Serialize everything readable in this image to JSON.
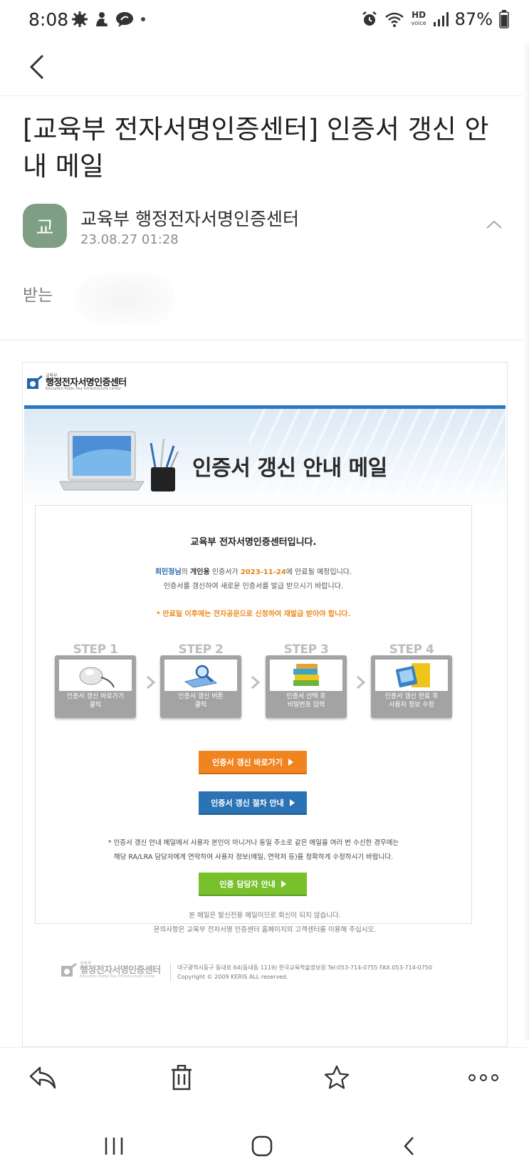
{
  "status_bar": {
    "time": "8:08",
    "hd_label": "HD",
    "voice_label": "voice",
    "battery": "87%"
  },
  "mail": {
    "subject": "[교육부 전자서명인증센터] 인증서 갱신 안내 메일",
    "avatar_letter": "교",
    "sender": "교육부 행정전자서명인증센터",
    "date": "23.08.27 01:28",
    "recipient_label": "받는"
  },
  "email_body": {
    "logo_sup": "교육부",
    "logo_name": "행정전자서명인증센터",
    "logo_sub": "Education Public Key Infrastructure Center",
    "banner_title": "인증서 갱신 안내 메일",
    "intro_title": "교육부 전자서명인증센터입니다.",
    "line1": {
      "name": "최민정님",
      "p1": "의 ",
      "type": "개인용",
      "p2": " 인증서가 ",
      "expiry": "2023-11-24",
      "p3": "에 만료될 예정입니다."
    },
    "line2": "인증서를 갱신하여 새로운 인증서를 발급 받으시기 바랍니다.",
    "warning": "* 만료일 이후에는 전자공문으로 신청하여 재발급 받아야 합니다.",
    "steps": [
      {
        "label": "STEP 1",
        "text1": "인증서 갱신 바로가기",
        "text2": "클릭",
        "icon": "mouse-icon"
      },
      {
        "label": "STEP 2",
        "text1": "인증서 갱신 버튼",
        "text2": "클릭",
        "icon": "magnifier-icon"
      },
      {
        "label": "STEP 3",
        "text1": "인증서 선택 후",
        "text2": "비밀번호 입력",
        "icon": "books-icon"
      },
      {
        "label": "STEP 4",
        "text1": "인증서 갱신 완료 후",
        "text2": "사용자 정보 수정",
        "icon": "tablet-icon"
      }
    ],
    "btn_renew": "인증서 갱신 바로가기",
    "btn_guide": "인증서 갱신 절차 안내",
    "note1": "* 인증서 갱신 안내 메일에서 사용자 본인이 아니거나 동일 주소로 같은 메일을 여러 번 수신한 경우에는",
    "note2": "해당 RA/LRA 담당자에게 연락하여 사용자 정보(메일, 연락처 등)를 정확하게 수정하시기 바랍니다.",
    "btn_contact": "인증 담당자 안내",
    "footer1": "본 메일은 발신전용 메일이므로 회신이 되지 않습니다.",
    "footer2": "문의사항은 교육부 전자서명 인증센터 홈페이지의 고객센터를 이용해 주십시오.",
    "address": "대구광역시동구 동내로 64(동내동 1119) 한국교육학술정보원 Tel:053-714-0755 FAX.053-714-0750",
    "copyright": "Copyright © 2009 KERIS ALL reserved."
  },
  "colors": {
    "accent_blue": "#2a78c4",
    "orange": "#f0841e",
    "green": "#78c12d",
    "avatar": "#7e9f84"
  }
}
